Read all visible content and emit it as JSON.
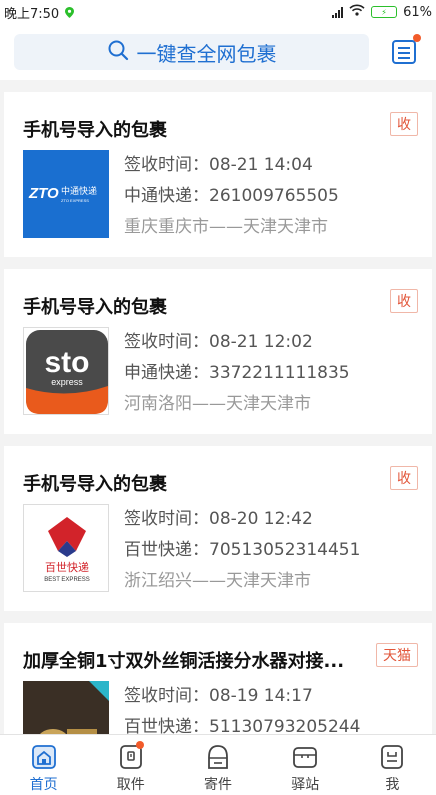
{
  "status_bar": {
    "time": "晚上7:50",
    "battery": "61%"
  },
  "search": {
    "placeholder": "一键查全网包裹"
  },
  "parcels": [
    {
      "title": "手机号导入的包裹",
      "tag": "收",
      "time": "签收时间：08-21 14:04",
      "courier": "中通快递：261009765505",
      "route": "重庆重庆市——天津天津市",
      "logo": "zto-logo"
    },
    {
      "title": "手机号导入的包裹",
      "tag": "收",
      "time": "签收时间：08-21 12:02",
      "courier": "申通快递：3372211111835",
      "route": "河南洛阳——天津天津市",
      "logo": "sto-logo"
    },
    {
      "title": "手机号导入的包裹",
      "tag": "收",
      "time": "签收时间：08-20 12:42",
      "courier": "百世快递：70513052314451",
      "route": "浙江绍兴——天津天津市",
      "logo": "best-logo"
    },
    {
      "title": "加厚全铜1寸双外丝铜活接分水器对接...",
      "tag": "天猫",
      "time": "签收时间：08-19 14:17",
      "courier": "百世快递：51130793205244",
      "route": "",
      "logo": "product-photo"
    }
  ],
  "logo_text": {
    "zto_main": "ZTO",
    "zto_cn": "中通快递",
    "zto_en": "ZTO EXPRESS",
    "sto_main": "sto",
    "sto_sub": "express",
    "best_cn": "百世快递",
    "best_en": "BEST EXPRESS"
  },
  "tabs": [
    {
      "label": "首页",
      "icon": "home-icon",
      "active": true
    },
    {
      "label": "取件",
      "icon": "pickup-icon",
      "active": false
    },
    {
      "label": "寄件",
      "icon": "send-icon",
      "active": false
    },
    {
      "label": "驿站",
      "icon": "station-icon",
      "active": false
    },
    {
      "label": "我",
      "icon": "profile-icon",
      "active": false
    }
  ],
  "colors": {
    "accent": "#1f6fd1",
    "badge": "#f25b2a",
    "tag": "#e2563a"
  }
}
